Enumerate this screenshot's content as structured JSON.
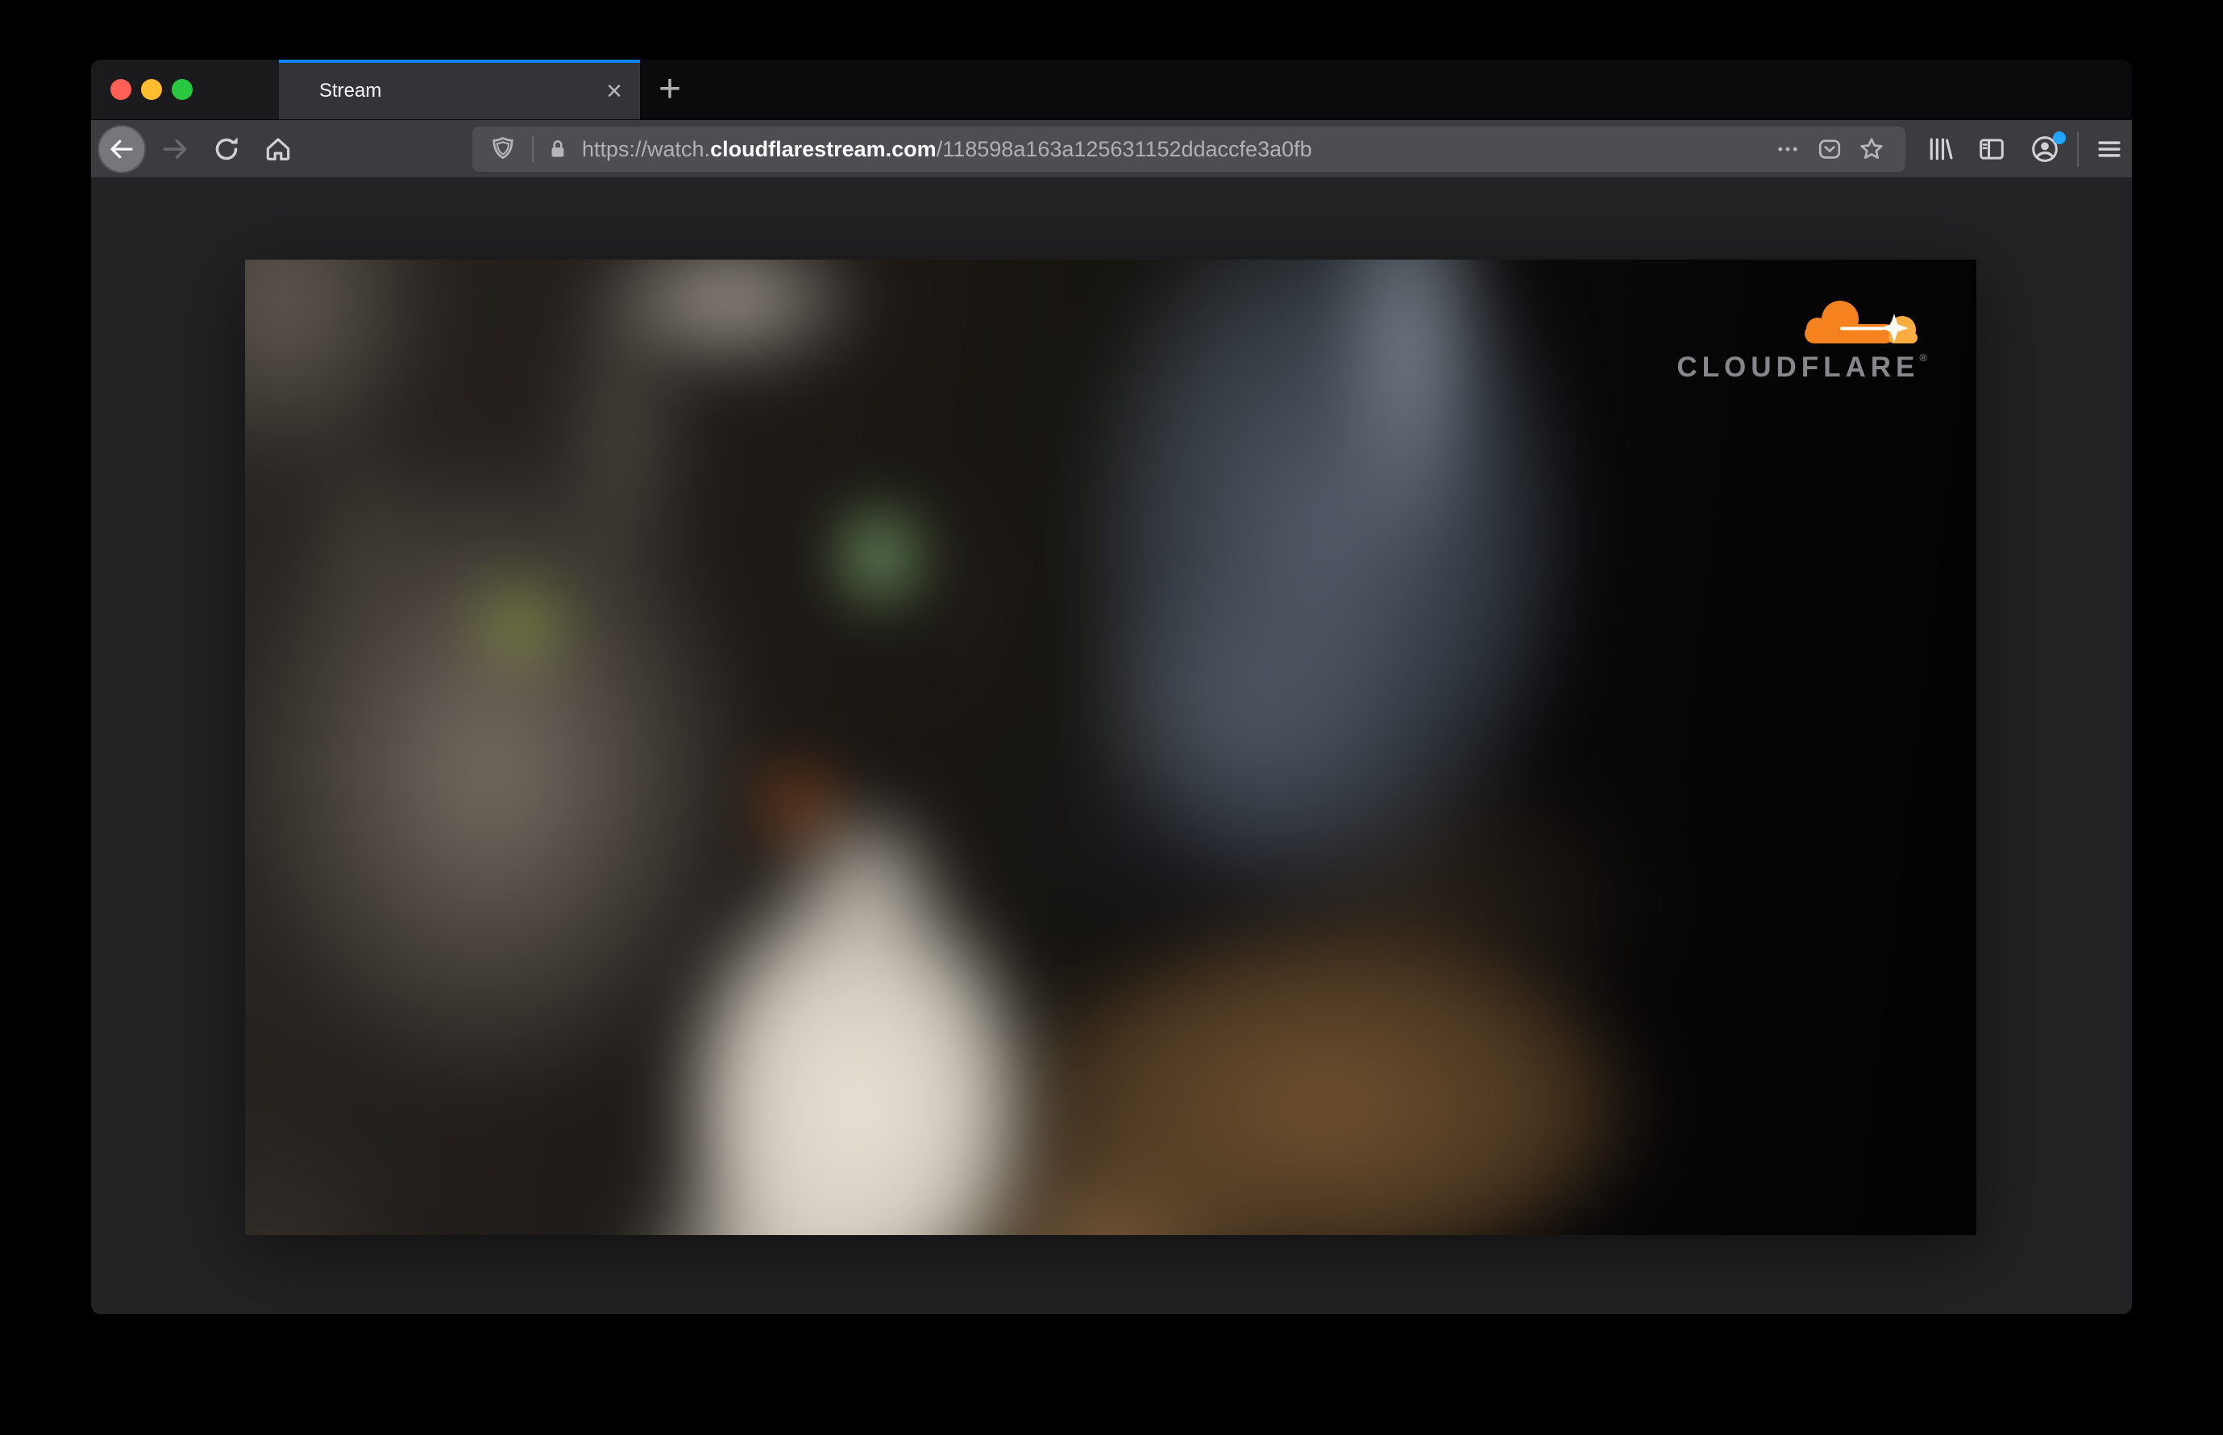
{
  "tab_bar": {
    "active_tab": {
      "label": "Stream",
      "close_glyph": "×"
    },
    "new_tab_glyph": "+"
  },
  "toolbar": {
    "url": {
      "prefix": "https://watch.",
      "domain": "cloudflarestream.com",
      "path": "/118598a163a125631152ddaccfe3a0fb"
    }
  },
  "video_overlay": {
    "brand_text": "CLOUDFLARE",
    "brand_trademark": "®"
  },
  "icons": {
    "back_icon": "left-arrow",
    "forward_icon": "right-arrow",
    "reload_icon": "circular-arrow",
    "home_icon": "house",
    "tracking_shield_icon": "shield-outline",
    "lock_icon": "padlock",
    "page_actions_icon": "three-dots",
    "pocket_icon": "pocket-chevron",
    "bookmark_star_icon": "star-outline",
    "library_icon": "tilted-books",
    "sidebar_icon": "split-panel",
    "account_icon": "person-in-circle",
    "menu_icon": "hamburger",
    "cloudflare_cloud_icon": "orange-cloud-with-sparkle"
  },
  "colors": {
    "tab_accent": "#0a84ff",
    "notification_dot": "#21a6ff",
    "traffic_red": "#ff5f57",
    "traffic_yellow": "#febc2e",
    "traffic_green": "#28c840",
    "cloudflare_orange": "#f6821f",
    "cloudflare_orange_light": "#fbad41",
    "toolbar_bg": "#3b3b40",
    "urlbar_bg": "#4d4d52",
    "tabbar_bg": "#0b0b0d",
    "active_tab_bg": "#333338",
    "content_bg": "#232325"
  }
}
